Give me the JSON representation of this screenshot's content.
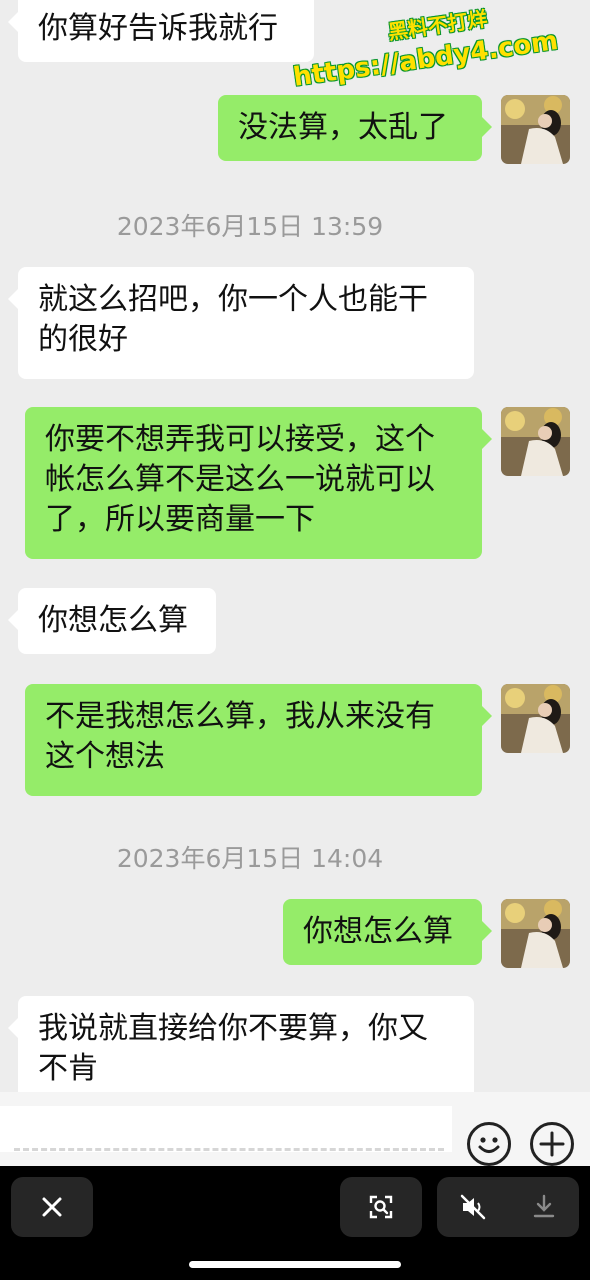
{
  "messages": [
    {
      "side": "left",
      "text": "你算好告诉我就行"
    },
    {
      "side": "right",
      "text": "没法算，太乱了"
    },
    {
      "type": "time",
      "text": "2023年6月15日 13:59"
    },
    {
      "side": "left",
      "text": "就这么招吧，你一个人也能干的很好"
    },
    {
      "side": "right",
      "text": "你要不想弄我可以接受，这个帐怎么算不是这么一说就可以了，所以要商量一下"
    },
    {
      "side": "left",
      "text": "你想怎么算"
    },
    {
      "side": "right",
      "text": "不是我想怎么算，我从来没有这个想法"
    },
    {
      "type": "time",
      "text": "2023年6月15日 14:04"
    },
    {
      "side": "right",
      "text": "你想怎么算"
    },
    {
      "side": "left",
      "text": "我说就直接给你不要算，你又不肯"
    }
  ],
  "watermark": {
    "line1": "黑料不打烊",
    "line2": "https://abdy4.com"
  },
  "icons": {
    "emoji": "emoji-face-icon",
    "plus": "plus-circle-icon",
    "close": "close-icon",
    "scan": "screenshot-scan-icon",
    "mute": "speaker-mute-icon",
    "download": "download-icon"
  },
  "colors": {
    "sent_bubble": "#95ec69",
    "received_bubble": "#ffffff",
    "background": "#ededed"
  }
}
